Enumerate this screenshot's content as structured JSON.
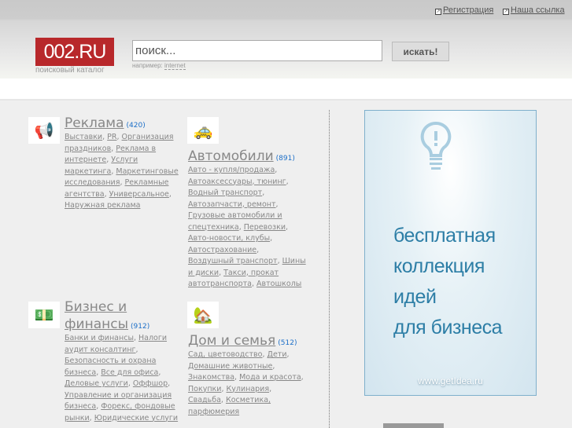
{
  "header": {
    "links": [
      "Регистрация",
      "Наша ссылка"
    ],
    "logo": "002.RU",
    "logo_sub": "поисковый каталог",
    "search_value": "поиск...",
    "hint_label": "например:",
    "hint_example": "internet",
    "search_button": "искать!"
  },
  "categories": [
    {
      "icon": "megaphone-icon",
      "title": "Реклама",
      "count": "(420)",
      "links": [
        "Выставки",
        "PR",
        "Организация праздников",
        "Реклама в интернете",
        "Услуги маркетинга",
        "Маркетинговые исследования",
        "Рекламные агентства",
        "Универсальное",
        "Наружная реклама"
      ]
    },
    {
      "icon": "car-icon",
      "title": "Автомобили",
      "count": "(891)",
      "links": [
        "Авто - купля/продажа",
        "Автоаксессуары, тюнинг",
        "Водный транспорт",
        "Автозапчасти, ремонт",
        "Грузовые автомобили и спецтехника",
        "Перевозки",
        "Авто-новости, клубы",
        "Автострахование",
        "Воздушный транспорт",
        "Шины и диски",
        "Такси, прокат автотранспорта",
        "Автошколы"
      ]
    },
    {
      "icon": "money-icon",
      "title": "Бизнес и финансы",
      "count": "(912)",
      "links": [
        "Банки и финансы",
        "Налоги аудит консалтинг",
        "Безопасность и охрана бизнеса",
        "Все для офиса",
        "Деловые услуги",
        "Оффшор",
        "Управление и организация бизнеса",
        "Форекс, фондовые рынки",
        "Юридические услуги"
      ]
    },
    {
      "icon": "house-icon",
      "title": "Дом и семья",
      "count": "(512)",
      "links": [
        "Сад, цветоводство",
        "Дети",
        "Домашние животные",
        "Знакомства",
        "Мода и красота",
        "Покупки",
        "Кулинария",
        "Свадьба",
        "Косметика, парфюмерия"
      ]
    }
  ],
  "ad": {
    "lines": [
      "бесплатная",
      "коллекция",
      "идей",
      "для бизнеса"
    ],
    "url": "www.getIdea.ru",
    "icon": "lightbulb-icon"
  }
}
